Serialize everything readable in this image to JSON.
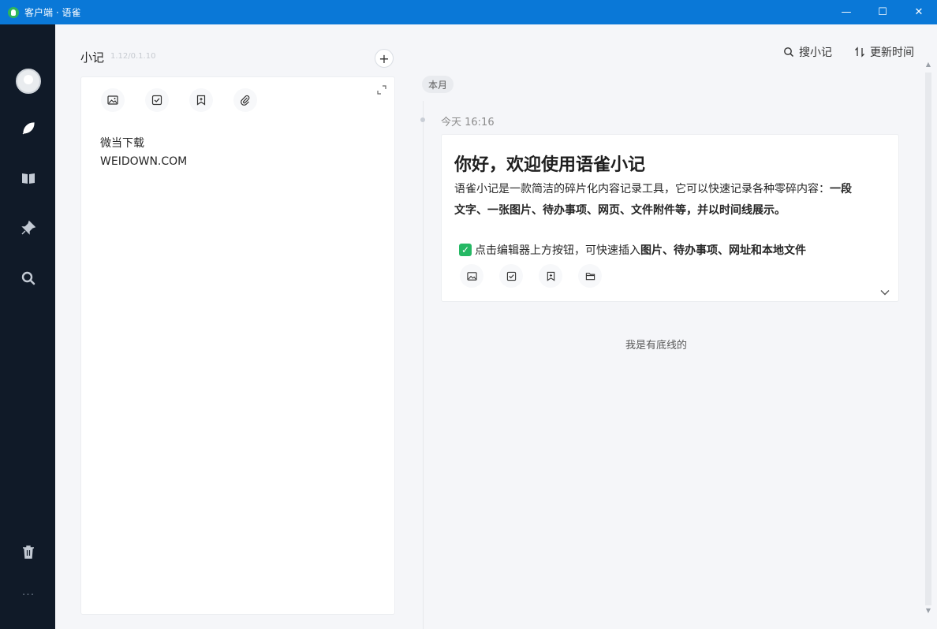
{
  "window": {
    "title": "客户端 · 语雀",
    "minimize": "—",
    "maximize": "☐",
    "close": "✕"
  },
  "sidebar": {
    "items": [
      {
        "name": "avatar"
      },
      {
        "name": "feather-icon"
      },
      {
        "name": "book-icon"
      },
      {
        "name": "pin-icon"
      },
      {
        "name": "search-icon"
      },
      {
        "name": "trash-icon"
      }
    ],
    "more": "···"
  },
  "notes": {
    "title": "小记",
    "version": "1.12/0.1.10",
    "add": "+",
    "editor_lines": [
      "微当下载",
      "WEIDOWN.COM"
    ]
  },
  "toolbar": {
    "search_label": "搜小记",
    "sort_label": "更新时间"
  },
  "timeline": {
    "month": "本月",
    "time": "今天 16:16",
    "card": {
      "title": "你好，欢迎使用语雀小记",
      "line1": "语雀小记是一款简洁的碎片化内容记录工具，它可以快速记录各种零碎内容：",
      "line1_bold": "一段",
      "line2_bold": "文字、一张图片、待办事项、网页、文件附件等，并以时间线展示。",
      "check_text": "点击编辑器上方按钮，可快速插入",
      "check_bold": "图片、待办事项、网址和本地文件"
    },
    "end_text": "我是有底线的"
  },
  "colors": {
    "titlebar": "#0a78d7",
    "sidebar": "#101a28",
    "accent_green": "#25b864",
    "background": "#f5f6f9"
  }
}
